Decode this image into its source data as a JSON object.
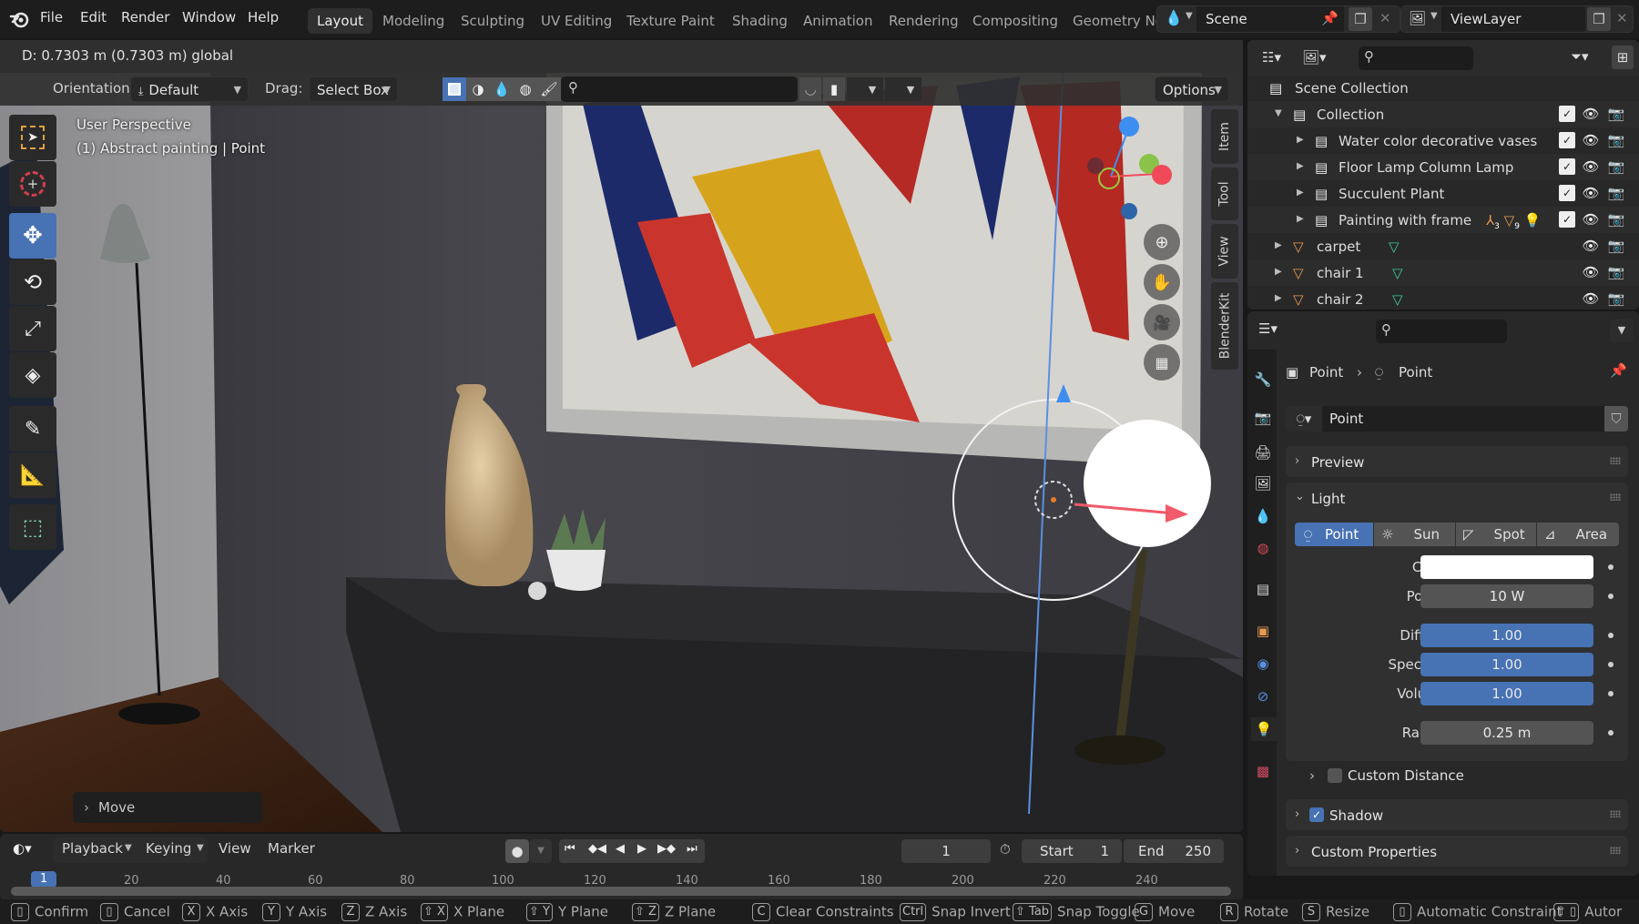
{
  "app": {
    "menu": [
      "File",
      "Edit",
      "Render",
      "Window",
      "Help"
    ],
    "workspaces": [
      {
        "label": "Layout",
        "active": true
      },
      {
        "label": "Modeling",
        "active": false
      },
      {
        "label": "Sculpting",
        "active": false
      },
      {
        "label": "UV Editing",
        "active": false
      },
      {
        "label": "Texture Paint",
        "active": false
      },
      {
        "label": "Shading",
        "active": false
      },
      {
        "label": "Animation",
        "active": false
      },
      {
        "label": "Rendering",
        "active": false
      },
      {
        "label": "Compositing",
        "active": false
      },
      {
        "label": "Geometry Nc",
        "active": false
      }
    ],
    "scene": "Scene",
    "view_layer": "ViewLayer"
  },
  "viewport": {
    "status_text": "D: 0.7303 m (0.7303 m) global",
    "orientation_label": "Orientation:",
    "orientation_value": "Default",
    "drag_label": "Drag:",
    "drag_value": "Select Box",
    "options_label": "Options",
    "overlay_title": "User Perspective",
    "overlay_subtitle": "(1) Abstract painting | Point",
    "side_tabs": [
      "Item",
      "Tool",
      "View",
      "BlenderKit"
    ],
    "operator_panel": "Move",
    "gizmo_axes": [
      "Z",
      "Y",
      "X"
    ],
    "tools": [
      "select-box",
      "cursor",
      "move",
      "rotate",
      "scale",
      "transform",
      "annotate",
      "measure",
      "add-cube"
    ],
    "active_tool": "move"
  },
  "outliner": {
    "root": "Scene Collection",
    "rows": [
      {
        "label": "Collection",
        "depth": 1,
        "expanded": true,
        "type": "collection",
        "checked": true
      },
      {
        "label": "Water color decorative vases",
        "depth": 2,
        "type": "collection",
        "checked": true
      },
      {
        "label": "Floor Lamp Column Lamp",
        "depth": 2,
        "type": "collection",
        "checked": true
      },
      {
        "label": "Succulent Plant",
        "depth": 2,
        "type": "collection",
        "checked": true
      },
      {
        "label": "Painting with frame",
        "depth": 2,
        "type": "collection",
        "checked": true,
        "badges": [
          "3",
          "9"
        ]
      },
      {
        "label": "carpet",
        "depth": 1,
        "type": "mesh"
      },
      {
        "label": "chair 1",
        "depth": 1,
        "type": "mesh"
      },
      {
        "label": "chair 2",
        "depth": 1,
        "type": "mesh"
      }
    ]
  },
  "properties": {
    "breadcrumb_object": "Point",
    "breadcrumb_data": "Point",
    "datablock_name": "Point",
    "panels": {
      "preview": "Preview",
      "light": "Light",
      "shadow": "Shadow",
      "custom_properties": "Custom Properties",
      "custom_distance": "Custom Distance"
    },
    "light_types": [
      {
        "label": "Point",
        "active": true
      },
      {
        "label": "Sun",
        "active": false
      },
      {
        "label": "Spot",
        "active": false
      },
      {
        "label": "Area",
        "active": false
      }
    ],
    "fields": {
      "color_label": "Color",
      "color_value": "#ffffff",
      "power_label": "Power",
      "power_value": "10 W",
      "diffuse_label": "Diffuse",
      "diffuse_value": "1.00",
      "specular_label": "Specular",
      "specular_value": "1.00",
      "volume_label": "Volume",
      "volume_value": "1.00",
      "radius_label": "Radius",
      "radius_value": "0.25 m"
    },
    "shadow_enabled": true,
    "custom_distance_enabled": false
  },
  "timeline": {
    "menus": [
      "Playback",
      "Keying",
      "View",
      "Marker"
    ],
    "current_frame": "1",
    "start_label": "Start",
    "start_value": "1",
    "end_label": "End",
    "end_value": "250",
    "frame_marker": "1",
    "ticks": [
      "20",
      "40",
      "60",
      "80",
      "100",
      "120",
      "140",
      "160",
      "180",
      "200",
      "220",
      "240"
    ]
  },
  "statusbar": {
    "items": [
      {
        "key": "mouse-left",
        "label": "Confirm"
      },
      {
        "key": "mouse-right",
        "label": "Cancel"
      },
      {
        "key": "X",
        "label": "X Axis"
      },
      {
        "key": "Y",
        "label": "Y Axis"
      },
      {
        "key": "Z",
        "label": "Z Axis"
      },
      {
        "key": "⇧ X",
        "label": "X Plane"
      },
      {
        "key": "⇧ Y",
        "label": "Y Plane"
      },
      {
        "key": "⇧ Z",
        "label": "Z Plane"
      },
      {
        "key": "C",
        "label": "Clear Constraints"
      },
      {
        "key": "Ctrl",
        "label": "Snap Invert"
      },
      {
        "key": "⇧ Tab",
        "label": "Snap Toggle"
      },
      {
        "key": "G",
        "label": "Move"
      },
      {
        "key": "R",
        "label": "Rotate"
      },
      {
        "key": "S",
        "label": "Resize"
      },
      {
        "key": "mouse-middle",
        "label": "Automatic Constraint"
      },
      {
        "key": "⇧ mouse-middle",
        "label": "Autor"
      }
    ]
  },
  "colors": {
    "accent": "#4772b3",
    "axis_x": "#f04a5a",
    "axis_y": "#8bc34a",
    "axis_z": "#3d8ef0",
    "object_orange": "#e89a52",
    "mesh_teal": "#3cc9a0"
  }
}
